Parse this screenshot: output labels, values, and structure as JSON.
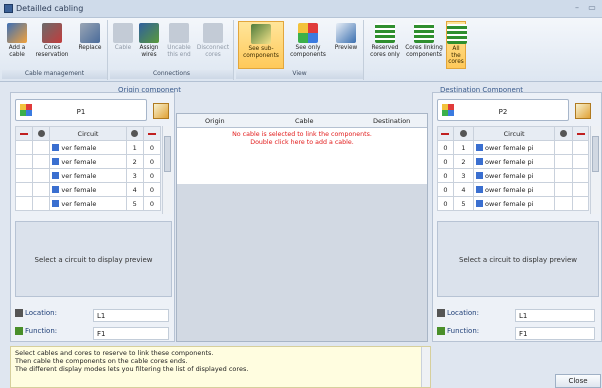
{
  "window": {
    "title": "Detailled cabling"
  },
  "ribbon": {
    "groups": [
      {
        "label": "Cable management"
      },
      {
        "label": "Connections"
      },
      {
        "label": "View"
      }
    ],
    "buttons": {
      "add_cable": "Add a cable",
      "cores_reservation": "Cores reservation",
      "replace": "Replace",
      "cable": "Cable",
      "assign_wires": "Assign wires",
      "uncable_this_end": "Uncable this end",
      "disconnect_cores": "Disconnect cores",
      "see_subcomponents": "See sub-components",
      "see_only_components": "See only components",
      "preview": "Preview",
      "reserved_cores_only": "Reserved cores only",
      "cores_linking_components": "Cores linking components",
      "all_the_cores": "All the cores"
    }
  },
  "origin": {
    "header": "Origin component",
    "name": "P1",
    "columns": {
      "circuit": "Circuit"
    },
    "rows": [
      {
        "circuit": "ver female",
        "n": "1",
        "v": "0"
      },
      {
        "circuit": "ver female",
        "n": "2",
        "v": "0"
      },
      {
        "circuit": "ver female",
        "n": "3",
        "v": "0"
      },
      {
        "circuit": "ver female",
        "n": "4",
        "v": "0"
      },
      {
        "circuit": "ver female",
        "n": "5",
        "v": "0"
      }
    ],
    "preview": "Select a circuit to display preview",
    "location_label": "Location:",
    "location_value": "L1",
    "function_label": "Function:",
    "function_value": "F1"
  },
  "destination": {
    "header": "Destination Component",
    "name": "P2",
    "columns": {
      "circuit": "Circuit"
    },
    "rows": [
      {
        "a": "0",
        "n": "1",
        "circuit": "ower female pi"
      },
      {
        "a": "0",
        "n": "2",
        "circuit": "ower female pi"
      },
      {
        "a": "0",
        "n": "3",
        "circuit": "ower female pi"
      },
      {
        "a": "0",
        "n": "4",
        "circuit": "ower female pi"
      },
      {
        "a": "0",
        "n": "5",
        "circuit": "ower female pi"
      }
    ],
    "preview": "Select a circuit to display preview",
    "location_label": "Location:",
    "location_value": "L1",
    "function_label": "Function:",
    "function_value": "F1"
  },
  "cable": {
    "columns": {
      "origin": "Origin",
      "cable": "Cable",
      "destination": "Destination"
    },
    "message1": "No cable is selected to link the components.",
    "message2": "Double click here to add a cable."
  },
  "help": {
    "line1": "Select cables and cores to reserve to link these components.",
    "line2": "Then cable the components on the cable cores ends.",
    "line3": "The different display modes lets you filtering the list of displayed cores."
  },
  "footer": {
    "close": "Close"
  },
  "colors": {
    "accent": "#ffc95a",
    "error_text": "#e21c1c",
    "section_header": "#3b5b8c"
  }
}
